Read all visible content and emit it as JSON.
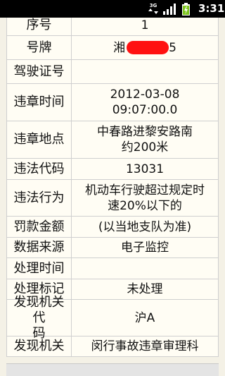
{
  "status_bar": {
    "network": "3G",
    "time": "3:31",
    "icons": [
      "3g-icon",
      "signal-icon",
      "battery-charging-icon"
    ]
  },
  "rows": [
    {
      "label": "序号",
      "value": "1"
    },
    {
      "label": "号牌",
      "value": "湘",
      "redacted": true,
      "value_suffix": "5"
    },
    {
      "label": "驾驶证号",
      "value": ""
    },
    {
      "label": "违章时间",
      "value": "2012-03-08\n09:07:00.0"
    },
    {
      "label": "违章地点",
      "value": "中春路进黎安路南\n约200米"
    },
    {
      "label": "违法代码",
      "value": "13031"
    },
    {
      "label": "违法行为",
      "value": "机动车行驶超过规定时\n速20%以下的"
    },
    {
      "label": "罚款金额",
      "value": "(以当地支队为准)"
    },
    {
      "label": "数据来源",
      "value": "电子监控"
    },
    {
      "label": "处理时间",
      "value": ""
    },
    {
      "label": "处理标记",
      "value": "未处理"
    },
    {
      "label": "发现机关代\n码",
      "value": "沪A"
    },
    {
      "label": "发现机关",
      "value": "闵行事故违章审理科"
    }
  ]
}
